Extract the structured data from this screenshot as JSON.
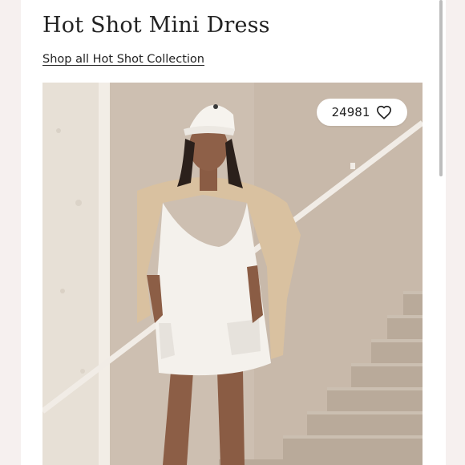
{
  "product": {
    "title": "Hot Shot Mini Dress",
    "collection_link": "Shop all Hot Shot Collection"
  },
  "listing": {
    "like_count": "24981",
    "like_icon": "heart-outline-icon"
  },
  "photo": {
    "description_icon": "product-photo"
  },
  "colors": {
    "background": "#fbf7f6",
    "text": "#222222"
  }
}
